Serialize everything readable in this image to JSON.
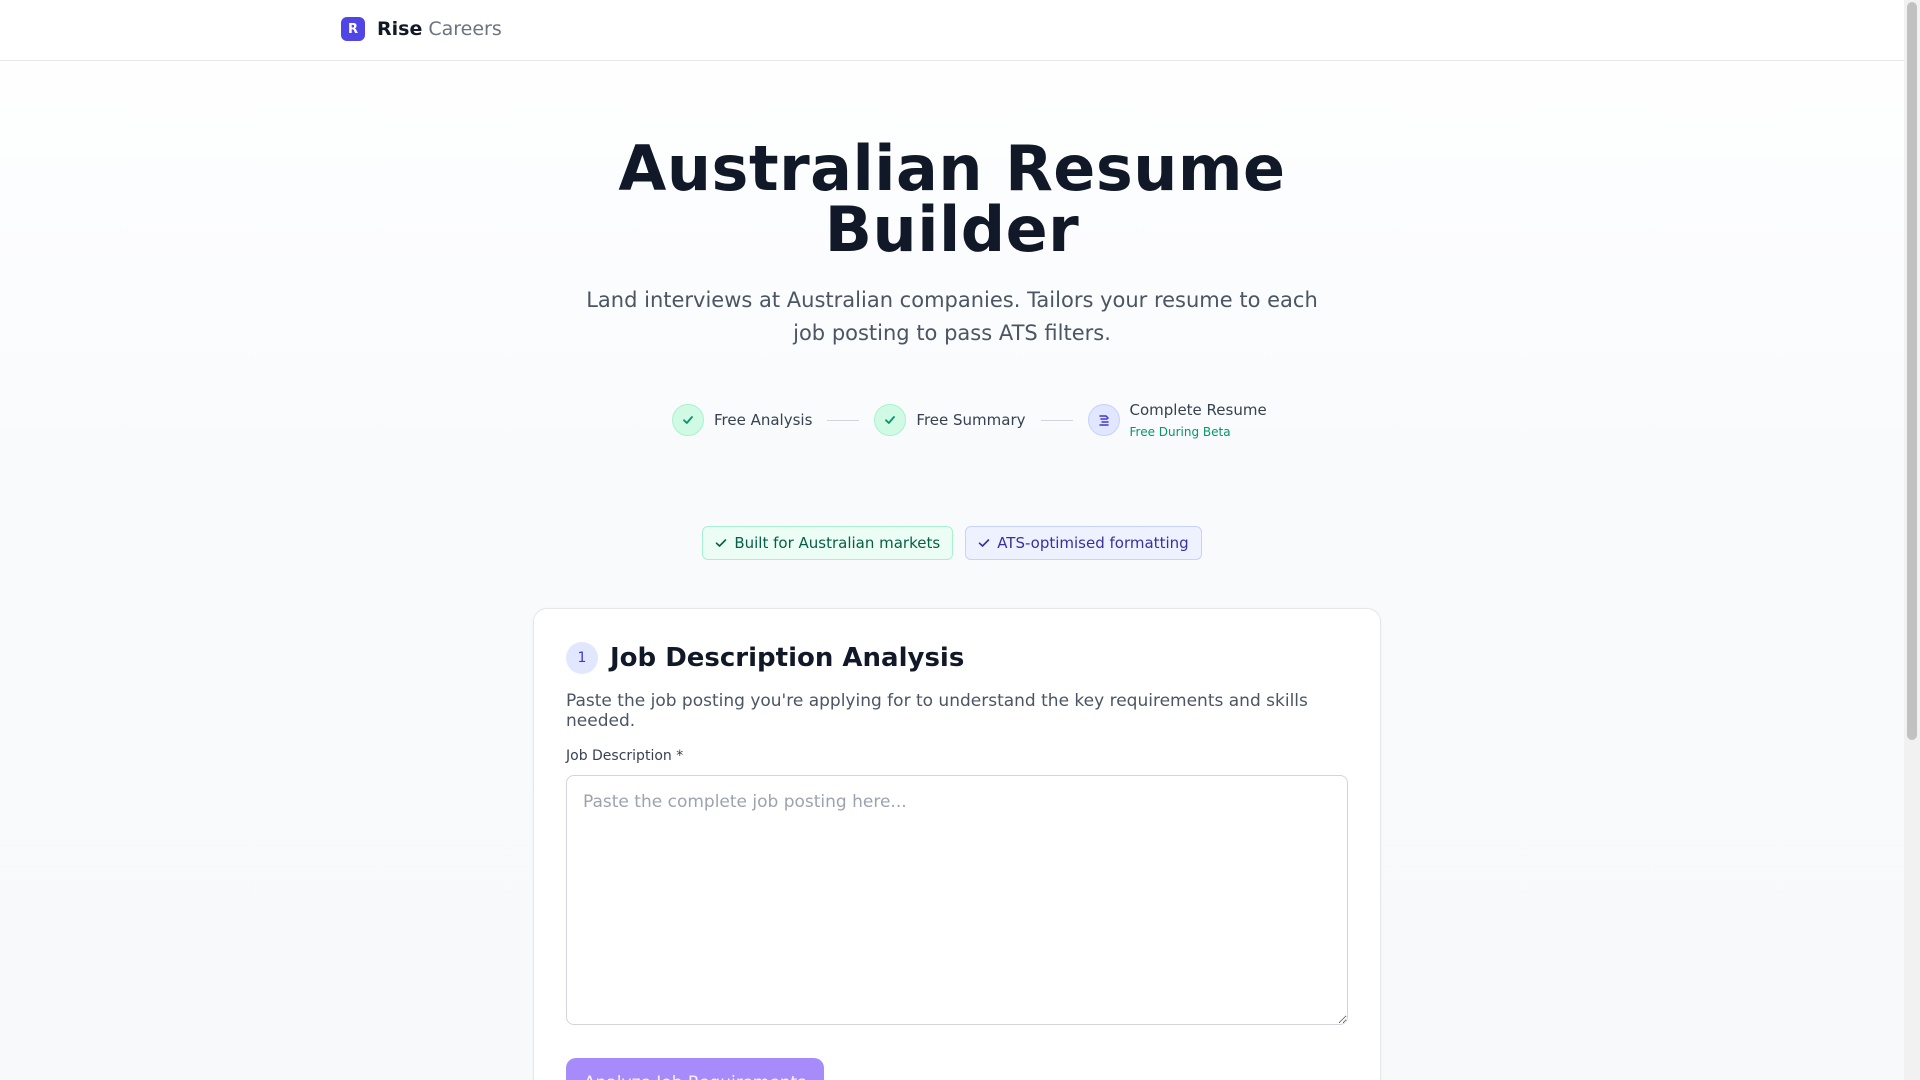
{
  "brand": {
    "mark": "R",
    "name": "Rise",
    "sub": "Careers"
  },
  "hero": {
    "title_line1": "Australian Resume",
    "title_line2": "Builder",
    "subtitle": "Land interviews at Australian companies. Tailors your resume to each job posting to pass ATS filters."
  },
  "steps": [
    {
      "label": "Free Analysis",
      "state": "done",
      "icon": "check-icon"
    },
    {
      "label": "Free Summary",
      "state": "done",
      "icon": "check-icon"
    },
    {
      "label": "Complete Resume",
      "sublabel": "Free During Beta",
      "state": "active",
      "icon": "document-icon"
    }
  ],
  "badges": [
    {
      "label": "Built for Australian markets",
      "color": "#065f46"
    },
    {
      "label": "ATS-optimised formatting",
      "color": "#3730a3"
    }
  ],
  "card": {
    "step_number": "1",
    "title": "Job Description Analysis",
    "description": "Paste the job posting you're applying for to understand the key requirements and skills needed.",
    "field_label": "Job Description *",
    "field_value": "",
    "field_placeholder": "Paste the complete job posting here...",
    "button_label": "Analyze Job Requirements"
  },
  "colors": {
    "accent": "#4f46e5",
    "success": "#10b981",
    "button_disabled": "#a78bfa"
  }
}
